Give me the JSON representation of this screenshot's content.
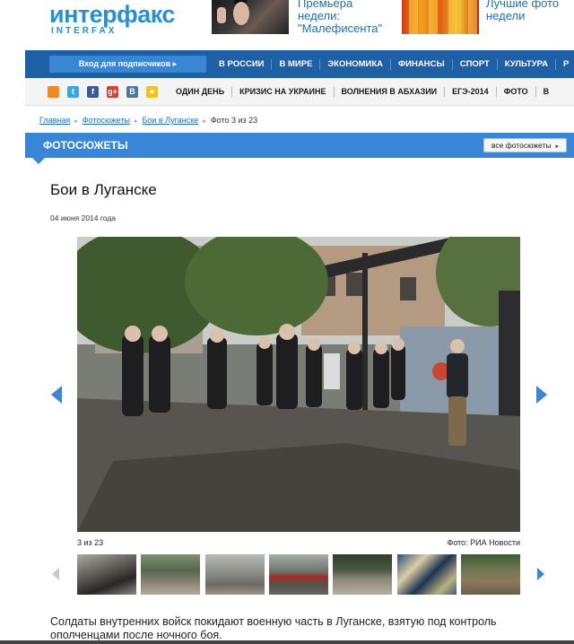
{
  "header": {
    "logo_main": "интерфакс",
    "logo_sub": "INTERFAX",
    "promos": [
      {
        "title": "Премьера недели: \"Малефисента\""
      },
      {
        "title": "Лучшие фото недели"
      }
    ]
  },
  "main_nav": {
    "login_label": "Вход для подписчиков ▸",
    "items": [
      "В РОССИИ",
      "В МИРЕ",
      "ЭКОНОМИКА",
      "ФИНАНСЫ",
      "СПОРТ",
      "КУЛЬТУРА",
      "Р"
    ]
  },
  "sub_nav": {
    "social": [
      {
        "icon": "rss-icon",
        "glyph": ""
      },
      {
        "icon": "twitter-icon",
        "glyph": "t"
      },
      {
        "icon": "facebook-icon",
        "glyph": "f"
      },
      {
        "icon": "google-plus-icon",
        "glyph": "g+"
      },
      {
        "icon": "vkontakte-icon",
        "glyph": "B"
      },
      {
        "icon": "favorite-star-icon",
        "glyph": "★"
      }
    ],
    "items": [
      "ОДИН ДЕНЬ",
      "КРИЗИС НА УКРАИНЕ",
      "ВОЛНЕНИЯ В АБХАЗИИ",
      "ЕГЭ-2014",
      "ФОТО",
      "В"
    ]
  },
  "breadcrumb": {
    "home": "Главная",
    "photostories": "Фотосюжеты",
    "story": "Бои в Луганске",
    "current": "Фото 3 из 23"
  },
  "section": {
    "title": "ФОТОСЮЖЕТЫ",
    "all_button": "все фотосюжеты"
  },
  "article": {
    "title": "Бои в Луганске",
    "date": "04 июня 2014 года",
    "photo_count": "3 из 23",
    "photo_credit": "Фото: РИА Новости",
    "caption": "Солдаты внутренних войск покидают военную часть в Луганске, взятую под контроль ополченцами после ночного боя."
  },
  "colors": {
    "brand_blue": "#1f5fa6",
    "accent_blue": "#3a86d6",
    "link_blue": "#1f6fb5"
  }
}
